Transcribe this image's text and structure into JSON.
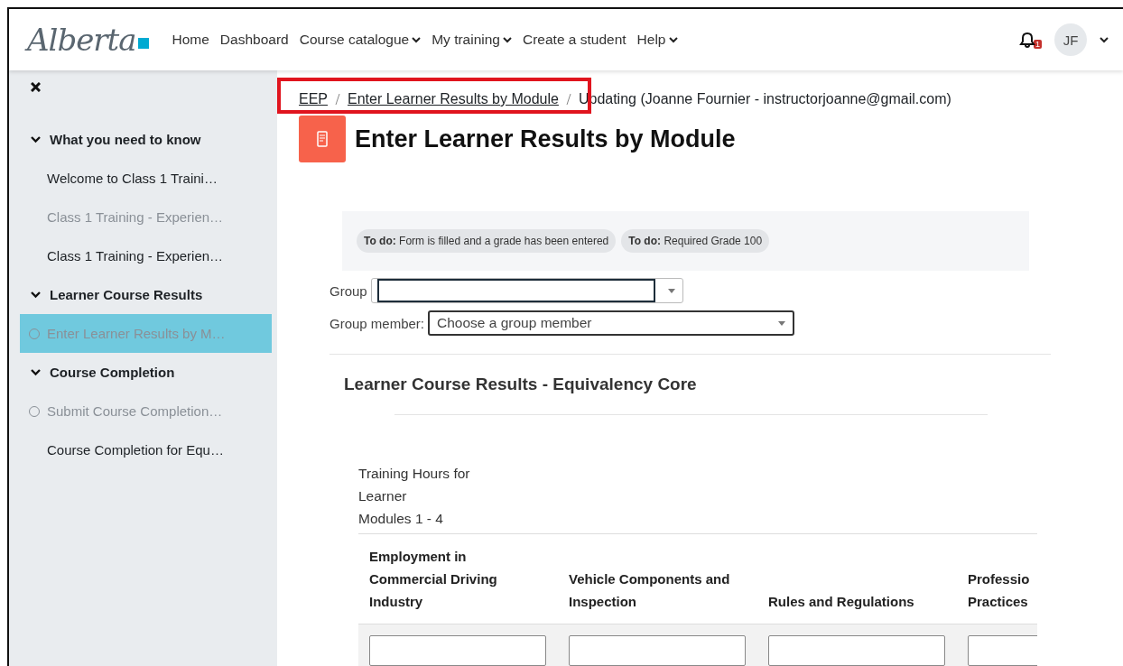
{
  "navbar": {
    "logo": "Alberta",
    "items": [
      {
        "label": "Home",
        "dropdown": false
      },
      {
        "label": "Dashboard",
        "dropdown": false
      },
      {
        "label": "Course catalogue",
        "dropdown": true
      },
      {
        "label": "My training",
        "dropdown": true
      },
      {
        "label": "Create a student",
        "dropdown": false
      },
      {
        "label": "Help",
        "dropdown": true
      }
    ],
    "notification_count": "1",
    "avatar": "JF"
  },
  "sidebar": {
    "sections": [
      {
        "title": "What you need to know",
        "expanded": true,
        "items": [
          {
            "label": "Welcome to Class 1 Traini…",
            "dimmed": false,
            "selected": false,
            "circle": false
          },
          {
            "label": "Class 1 Training - Experien…",
            "dimmed": true,
            "selected": false,
            "circle": false
          },
          {
            "label": "Class 1 Training - Experien…",
            "dimmed": false,
            "selected": false,
            "circle": false
          }
        ]
      },
      {
        "title": "Learner Course Results",
        "expanded": true,
        "items": [
          {
            "label": "Enter Learner Results by M…",
            "dimmed": true,
            "selected": true,
            "circle": true
          }
        ]
      },
      {
        "title": "Course Completion",
        "expanded": true,
        "items": [
          {
            "label": "Submit Course Completion…",
            "dimmed": true,
            "selected": false,
            "circle": true
          },
          {
            "label": "Course Completion for Equ…",
            "dimmed": false,
            "selected": false,
            "circle": false
          }
        ]
      }
    ]
  },
  "breadcrumb": {
    "highlighted": true,
    "links": [
      "EEP",
      "Enter Learner Results by Module"
    ],
    "current": "Updating (Joanne Fournier - instructorjoanne@gmail.com)"
  },
  "page_title": "Enter Learner Results by Module",
  "completion_badges": [
    {
      "label": "To do:",
      "text": "Form is filled and a grade has been entered"
    },
    {
      "label": "To do:",
      "text": "Required Grade 100"
    }
  ],
  "group": {
    "label": "Group"
  },
  "group_member": {
    "label": "Group member:",
    "value": "Choose a group member"
  },
  "section_title": "Learner Course Results - Equivalency Core",
  "hours_label": [
    "Training Hours for",
    "Learner",
    "Modules 1 - 4"
  ],
  "table": {
    "columns": [
      [
        "Employment in",
        "Commercial Driving",
        "Industry"
      ],
      [
        "Vehicle Components and",
        "Inspection"
      ],
      [
        "Rules and Regulations"
      ],
      [
        "Professio",
        "Practices"
      ]
    ]
  }
}
